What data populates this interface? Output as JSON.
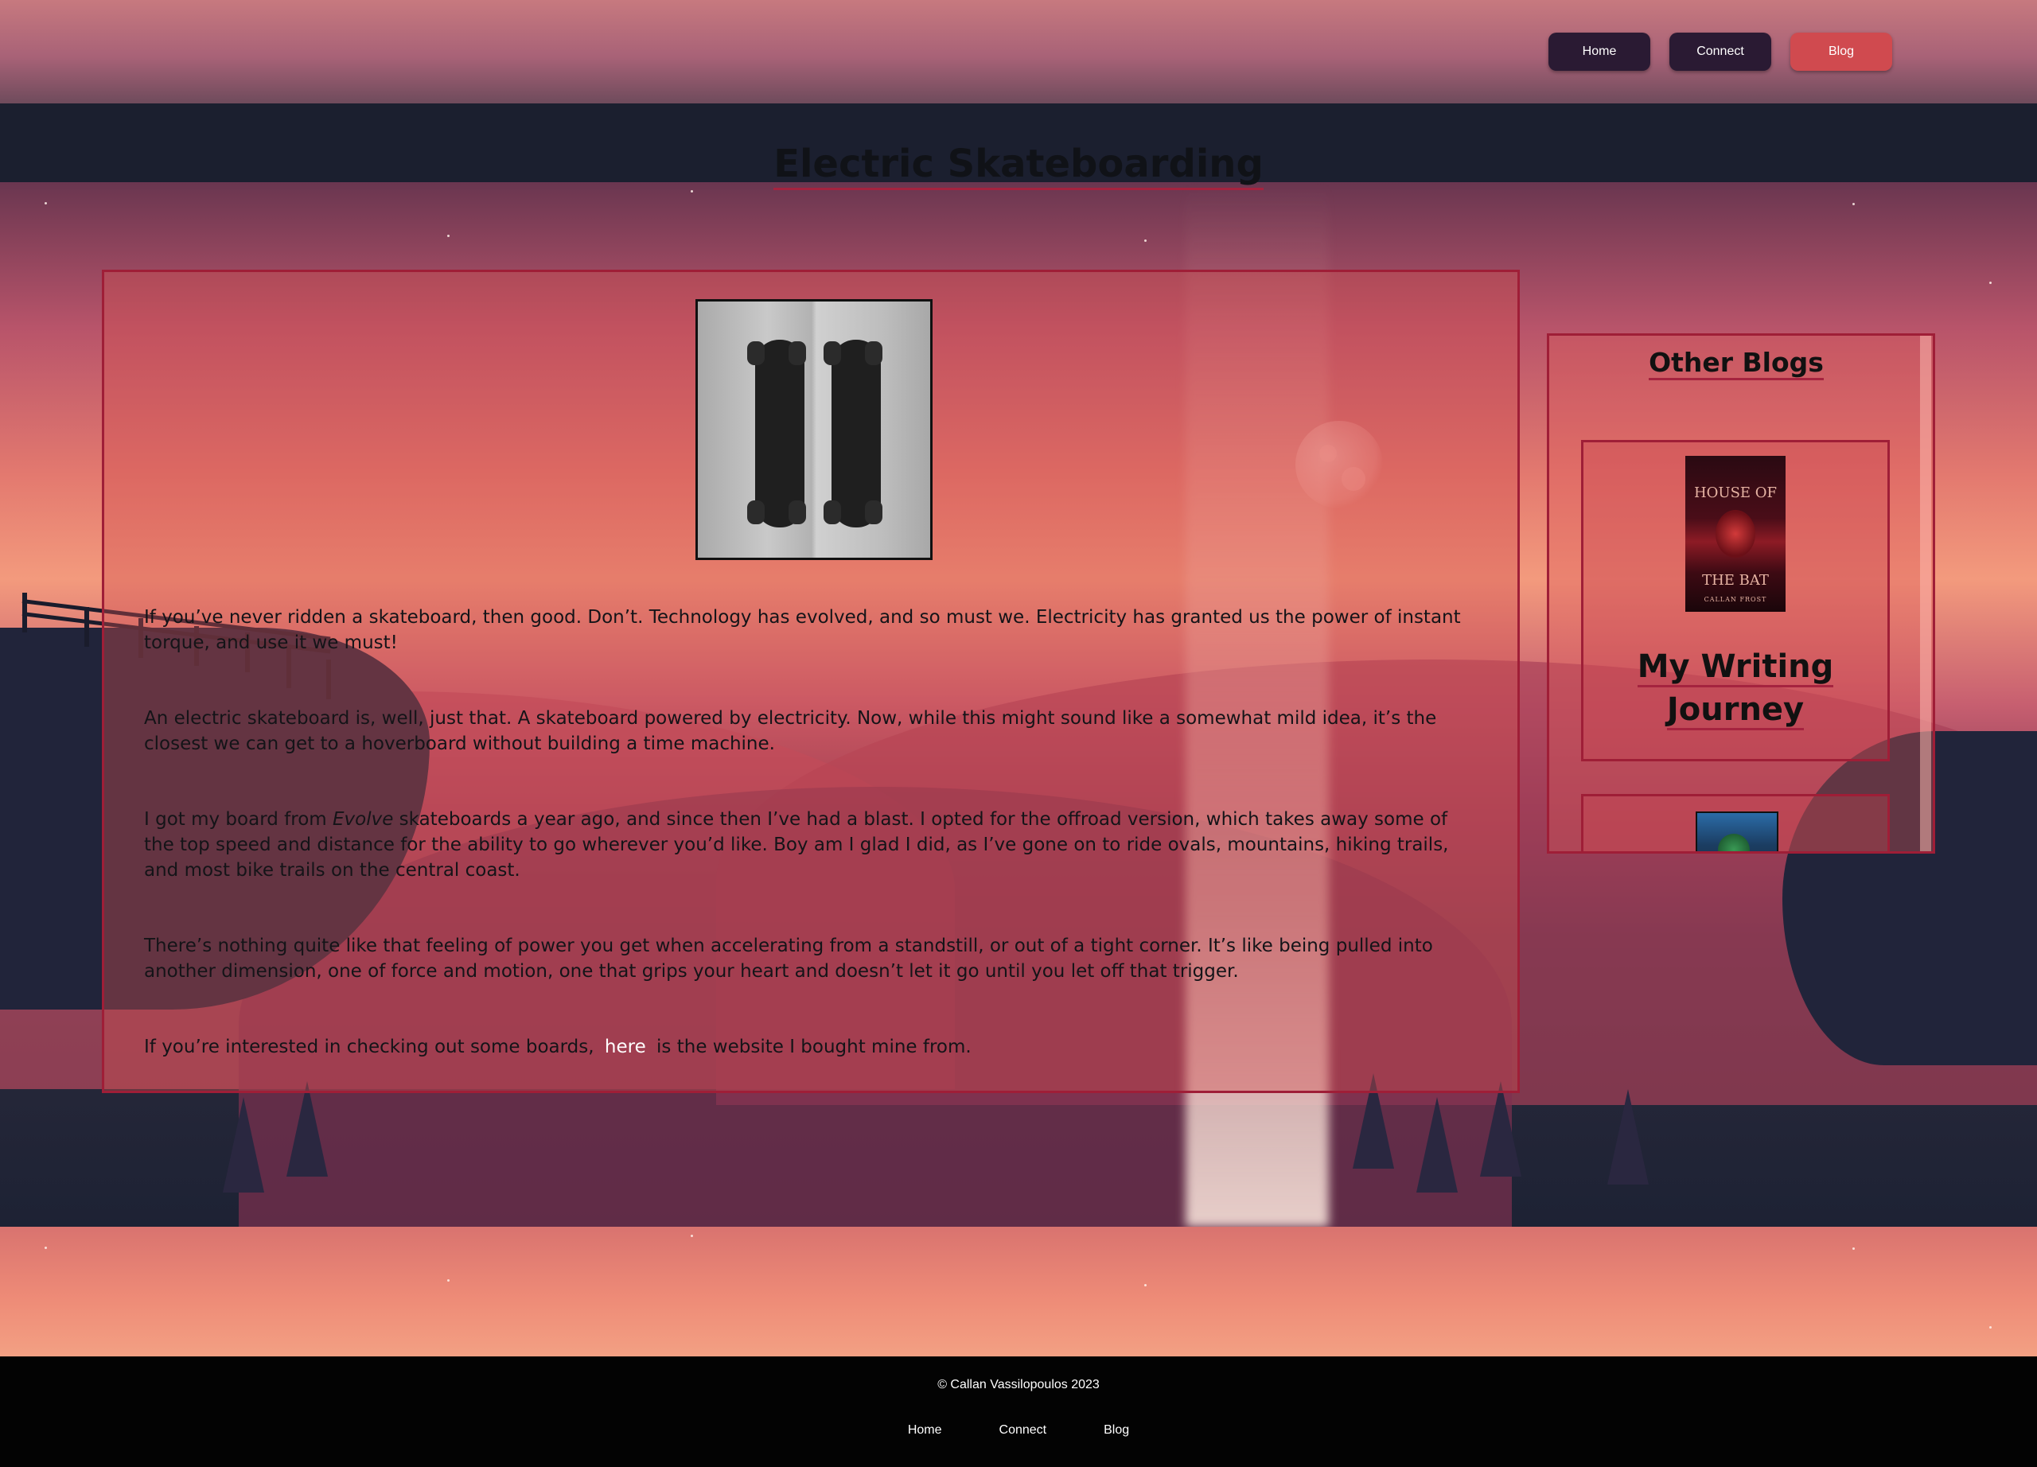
{
  "nav": {
    "items": [
      {
        "label": "Home"
      },
      {
        "label": "Connect"
      },
      {
        "label": "Blog"
      }
    ],
    "active": "Blog"
  },
  "page": {
    "title": "Electric Skateboarding"
  },
  "article": {
    "image_alt": "two electric skateboards",
    "p1": "If you’ve never ridden a skateboard, then good. Don’t. Technology has evolved, and so must we. Electricity has granted us the power of instant torque, and use it we must!",
    "p2": "An electric skateboard is, well, just that. A skateboard powered by electricity. Now, while this might sound like a somewhat mild idea, it’s the closest we can get to a hoverboard without building a time machine.",
    "p3_before": "I got my board from ",
    "p3_brand": "Evolve",
    "p3_after": " skateboards a year ago, and since then I’ve had a blast. I opted for the offroad version, which takes away some of the top speed and distance for the ability to go wherever you’d like. Boy am I glad I did, as I’ve gone on to ride ovals, mountains, hiking trails, and most bike trails on the central coast.",
    "p4": "There’s nothing quite like that feeling of power you get when accelerating from a standstill, or out of a tight corner. It’s like being pulled into another dimension, one of force and motion, one that grips your heart and doesn’t let it go until you let off that trigger.",
    "p5_before": "If you’re interested in checking out some boards, ",
    "p5_link": "here",
    "p5_after": " is the website I bought mine from."
  },
  "sidebar": {
    "title": "Other Blogs",
    "cards": [
      {
        "title_line1": "My Writing",
        "title_line2": "Journey",
        "cover": {
          "line1": "HOUSE OF",
          "line2": "THE BAT",
          "author": "CALLAN FROST"
        }
      }
    ]
  },
  "footer": {
    "copyright": "© Callan Vassilopoulos 2023",
    "links": [
      {
        "label": "Home"
      },
      {
        "label": "Connect"
      },
      {
        "label": "Blog"
      }
    ]
  },
  "colors": {
    "accent_red": "#d04a4f",
    "border_red": "#9f1e37",
    "nav_dark": "#2a1a33",
    "footer_bg": "#030303"
  }
}
